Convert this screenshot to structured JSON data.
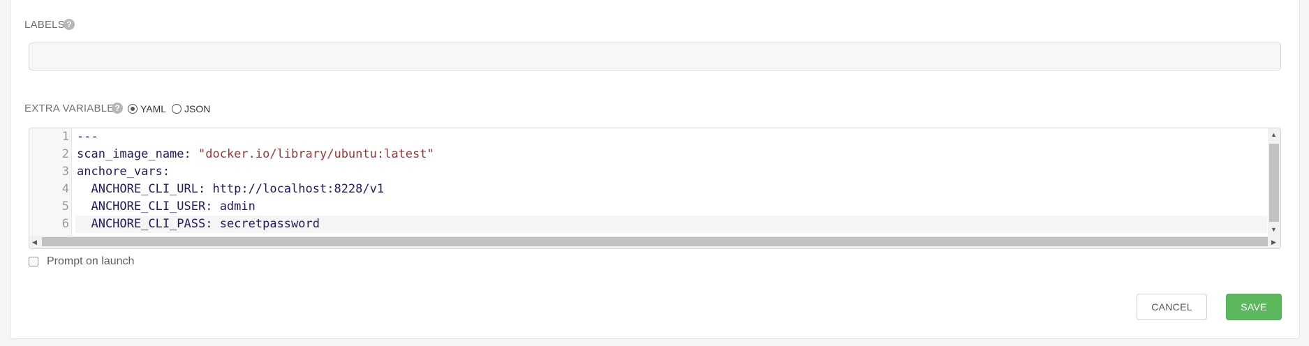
{
  "labels": {
    "label": "LABELS",
    "value": ""
  },
  "help_icon_glyph": "?",
  "extra_variables": {
    "label": "EXTRA VARIABLES",
    "format_options": [
      {
        "label": "YAML",
        "selected": true
      },
      {
        "label": "JSON",
        "selected": false
      }
    ],
    "lines": [
      {
        "number": "1",
        "key": "---",
        "value": ""
      },
      {
        "number": "2",
        "key": "scan_image_name: ",
        "value": "\"docker.io/library/ubuntu:latest\""
      },
      {
        "number": "3",
        "key": "anchore_vars:",
        "value": ""
      },
      {
        "number": "4",
        "key": "  ANCHORE_CLI_URL: http://localhost:8228/v1",
        "value": ""
      },
      {
        "number": "5",
        "key": "  ANCHORE_CLI_USER: admin",
        "value": ""
      },
      {
        "number": "6",
        "key": "  ANCHORE_CLI_PASS: secretpassword",
        "value": ""
      }
    ]
  },
  "prompt_on_launch": {
    "label": "Prompt on launch",
    "checked": false
  },
  "actions": {
    "cancel_label": "CANCEL",
    "save_label": "SAVE"
  },
  "colors": {
    "save_button": "#5cb85c",
    "code_text": "#1f1a63",
    "code_string": "#a23636"
  }
}
